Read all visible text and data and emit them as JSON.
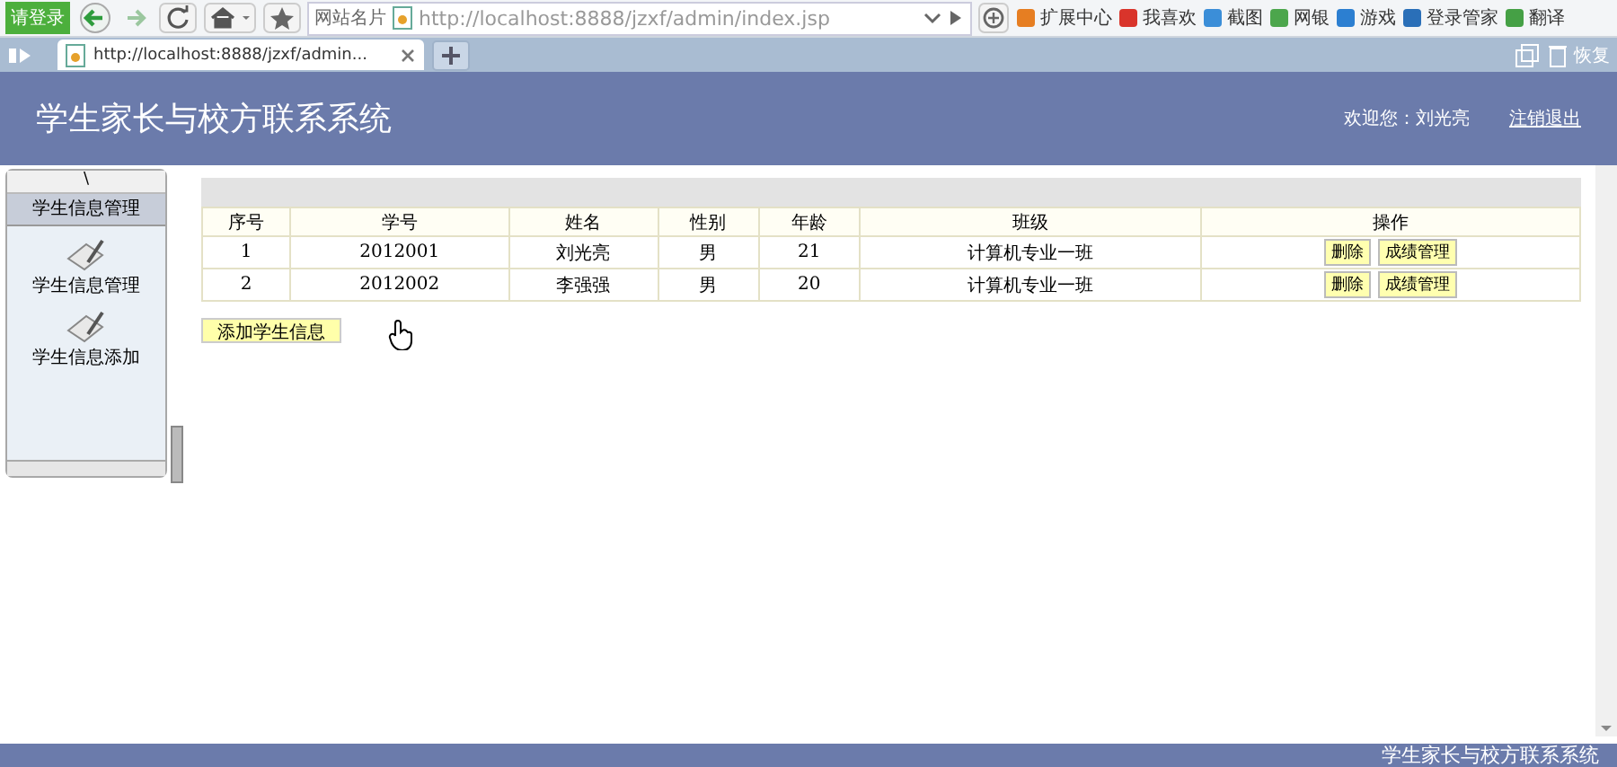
{
  "browser": {
    "login_button": "请登录",
    "site_card": "网站名片",
    "url": "http://localhost:8888/jzxf/admin/index.jsp",
    "toolbar": [
      "扩展中心",
      "我喜欢",
      "截图",
      "网银",
      "游戏",
      "登录管家",
      "翻译"
    ],
    "tabs": [
      {
        "label": "http://localhost:8888/jzxf/admin...",
        "selected": true
      }
    ],
    "restore": "恢复"
  },
  "header": {
    "title": "学生家长与校方联系系统",
    "welcome": "欢迎您：刘光亮",
    "logout": "注销退出"
  },
  "sidebar": {
    "toggle": "\\",
    "section": "学生信息管理",
    "items": [
      {
        "label": "学生信息管理"
      },
      {
        "label": "学生信息添加"
      }
    ]
  },
  "table": {
    "columns": [
      "序号",
      "学号",
      "姓名",
      "性别",
      "年龄",
      "班级",
      "操作"
    ],
    "rows": [
      {
        "cells": [
          "1",
          "2012001",
          "刘光亮",
          "男",
          "21",
          "计算机专业一班"
        ],
        "actions": [
          "删除",
          "成绩管理"
        ]
      },
      {
        "cells": [
          "2",
          "2012002",
          "李强强",
          "男",
          "20",
          "计算机专业一班"
        ],
        "actions": [
          "删除",
          "成绩管理"
        ]
      }
    ]
  },
  "add_button": "添加学生信息",
  "footer": "学生家长与校方联系系统"
}
